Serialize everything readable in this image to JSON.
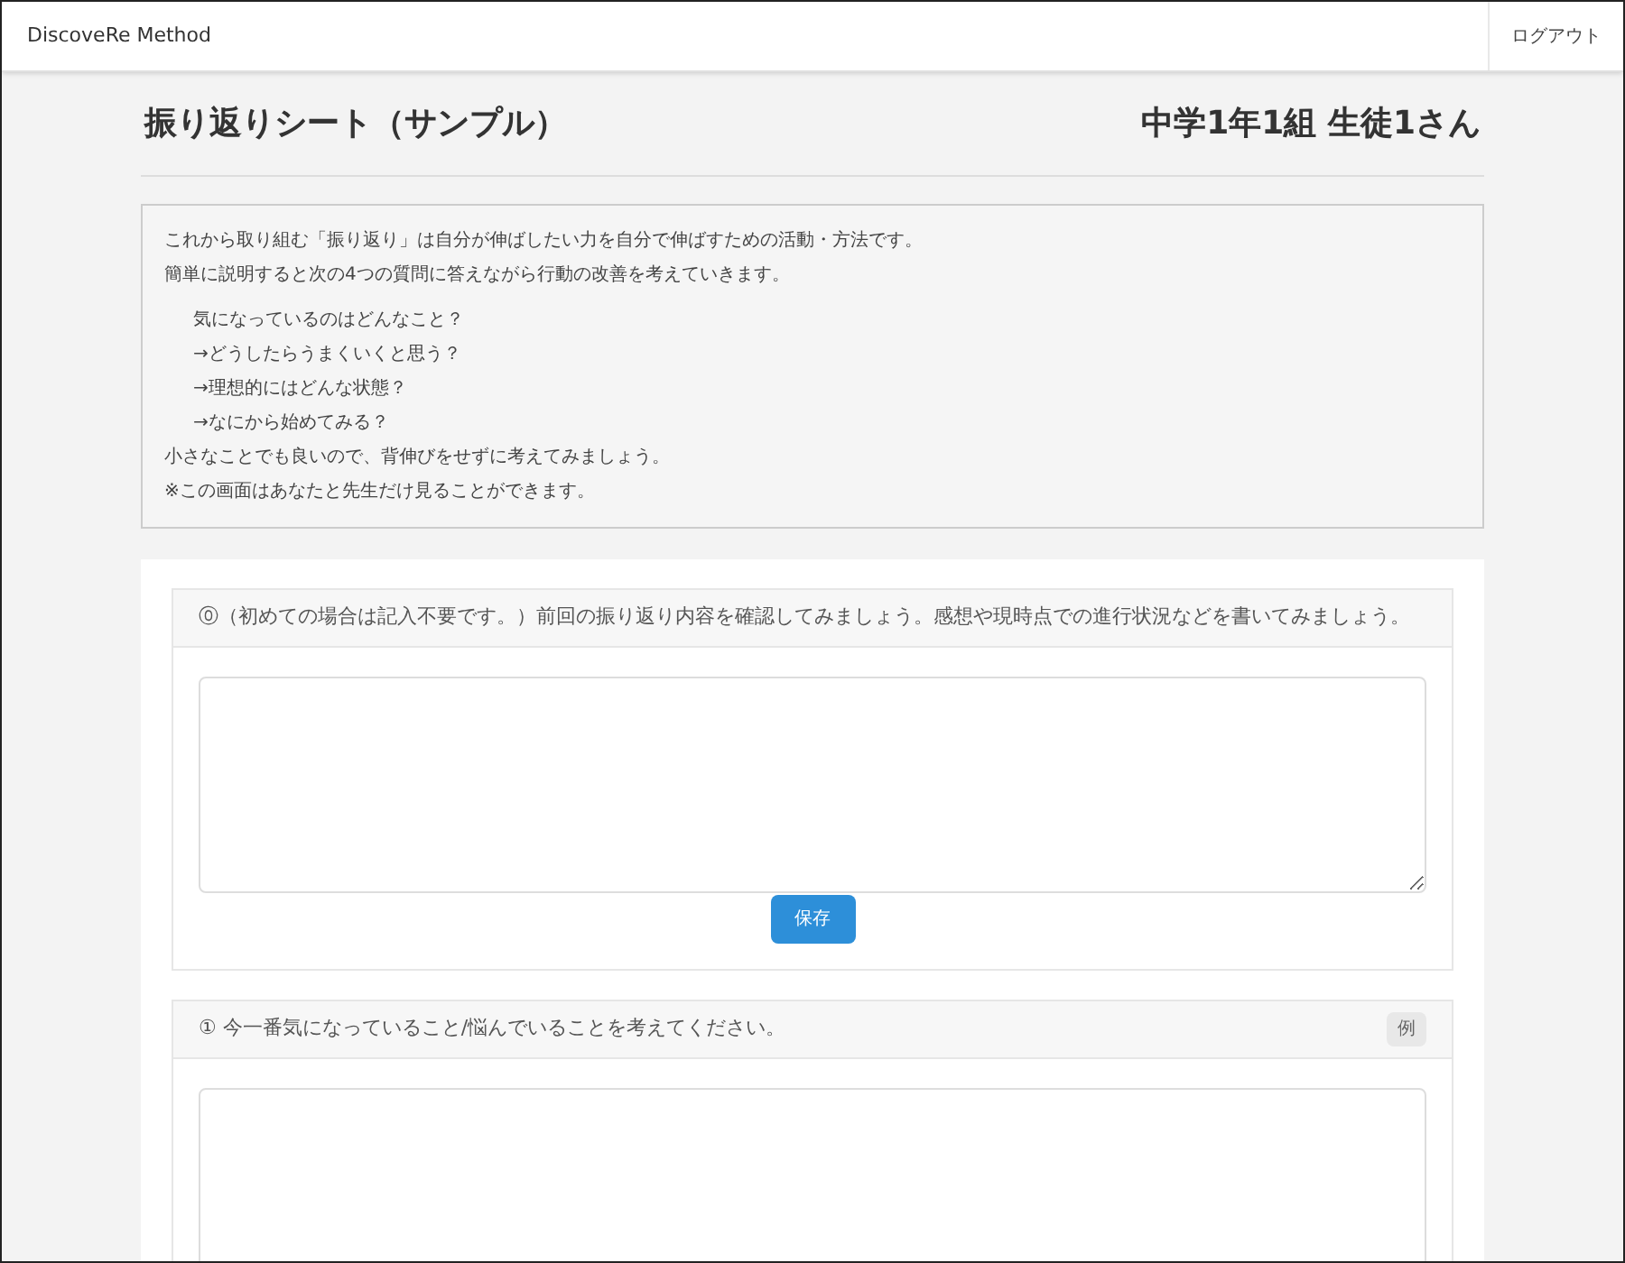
{
  "navbar": {
    "brand": "DiscoveRe Method",
    "logout": "ログアウト"
  },
  "header": {
    "title": "振り返りシート（サンプル）",
    "student": "中学1年1組 生徒1さん"
  },
  "intro": {
    "lines": [
      "これから取り組む「振り返り」は自分が伸ばしたい力を自分で伸ばすための活動・方法です。",
      "簡単に説明すると次の4つの質問に答えながら行動の改善を考えていきます。"
    ],
    "questions": [
      "気になっているのはどんなこと？",
      "→どうしたらうまくいくと思う？",
      "→理想的にはどんな状態？",
      "→なにから始めてみる？"
    ],
    "notes": [
      "小さなことでも良いので、背伸びをせずに考えてみましょう。",
      "※この画面はあなたと先生だけ見ることができます。"
    ]
  },
  "sections": [
    {
      "question": "⓪（初めての場合は記入不要です。）前回の振り返り内容を確認してみましょう。感想や現時点での進行状況などを書いてみましょう。",
      "save_button": "保存"
    },
    {
      "question": "① 今一番気になっていること/悩んでいることを考えてください。",
      "example_button": "例"
    }
  ]
}
